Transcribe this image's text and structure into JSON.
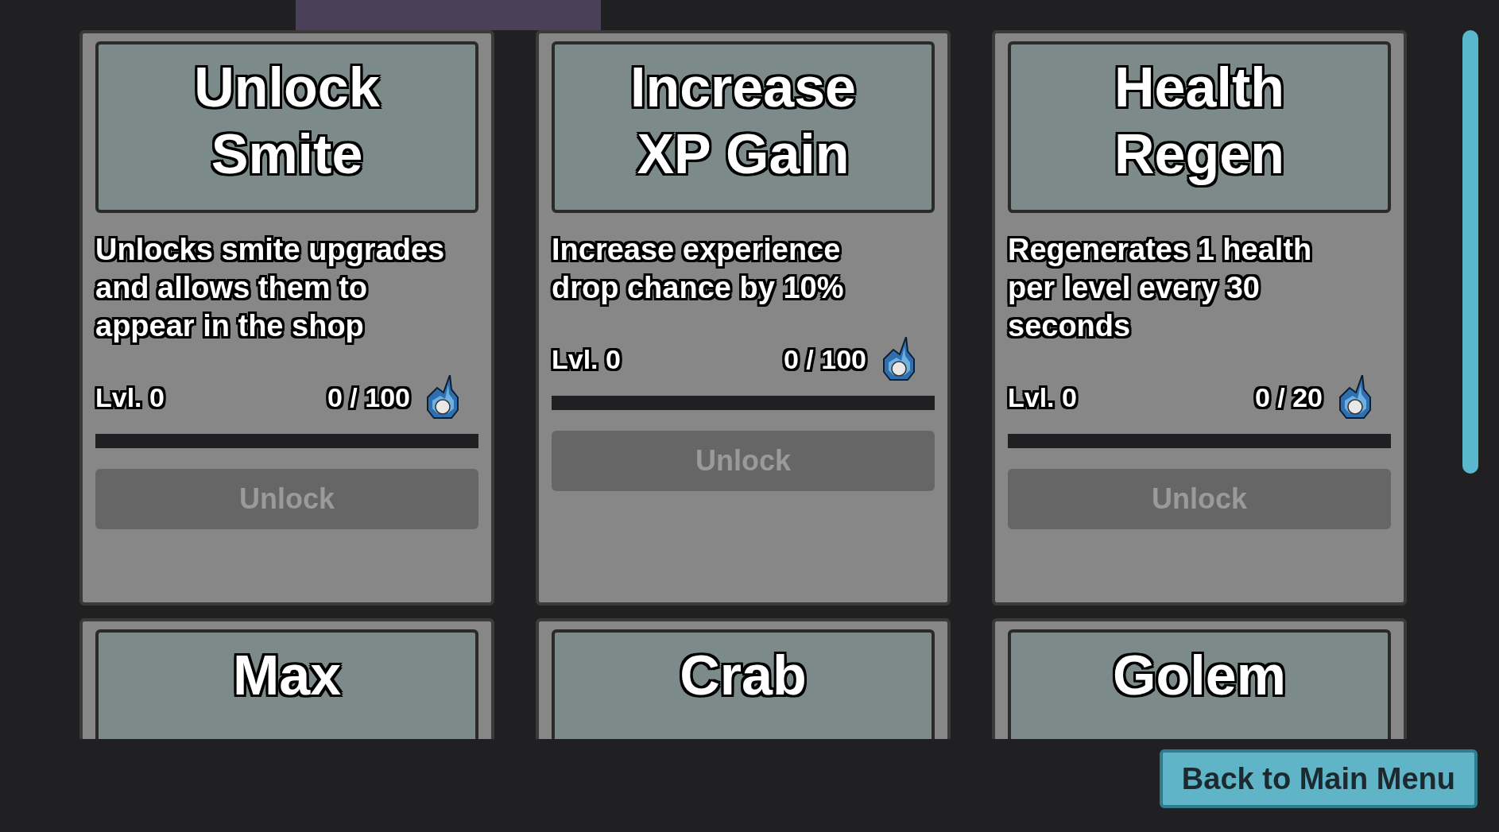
{
  "cards": [
    {
      "title": "Unlock Smite",
      "description": "Unlocks smite upgrades and allows them to appear in the shop",
      "level_label": "Lvl. 0",
      "cost": "0 / 100",
      "level": 0,
      "button": {
        "label": "Unlock",
        "disabled": true
      }
    },
    {
      "title": "Increase XP Gain",
      "description": "Increase experience drop chance by 10%",
      "level_label": "Lvl. 0",
      "cost": "0 / 100",
      "level": 0,
      "button": {
        "label": "Unlock",
        "disabled": true
      }
    },
    {
      "title": "Health Regen",
      "description": "Regenerates 1 health per level every 30 seconds",
      "level_label": "Lvl. 0",
      "cost": "0 / 20",
      "level": 0,
      "button": {
        "label": "Unlock",
        "disabled": true
      }
    },
    {
      "title": "Max"
    },
    {
      "title": "Crab"
    },
    {
      "title": "Golem"
    }
  ],
  "back_button": "Back to Main Menu"
}
